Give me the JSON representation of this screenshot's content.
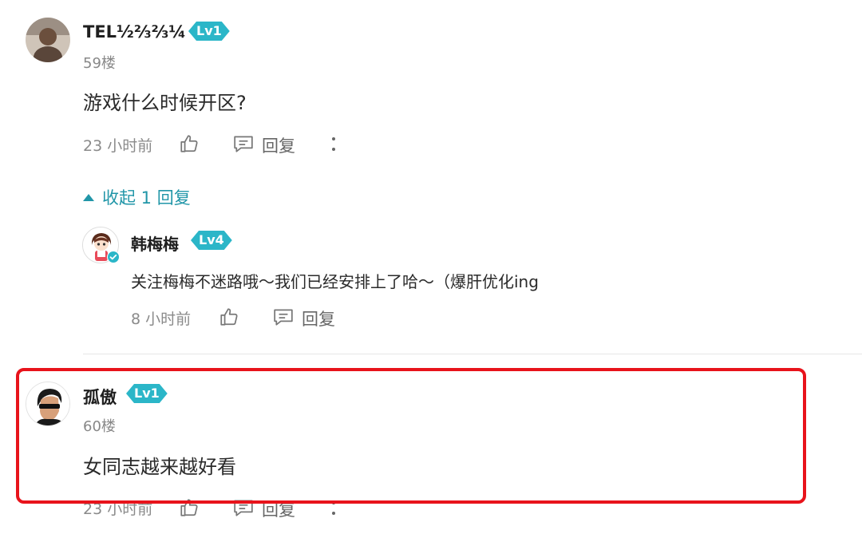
{
  "comments": [
    {
      "username": "TEL½⅔⅔¼",
      "level": "Lv1",
      "floor": "59楼",
      "text": "游戏什么时候开区?",
      "time": "23 小时前",
      "reply_label": "回复",
      "collapse_label": "收起 1 回复"
    },
    {
      "username": "孤傲",
      "level": "Lv1",
      "floor": "60楼",
      "text": "女同志越来越好看",
      "time": "23 小时前",
      "reply_label": "回复"
    }
  ],
  "reply": {
    "username": "韩梅梅",
    "level": "Lv4",
    "text": "关注梅梅不迷路哦～我们已经安排上了哈～（爆肝优化ing",
    "time": "8 小时前",
    "reply_label": "回复"
  },
  "colors": {
    "accent": "#2196a8",
    "level_badge": "#2bb6c8",
    "highlight_border": "#e8131b"
  }
}
